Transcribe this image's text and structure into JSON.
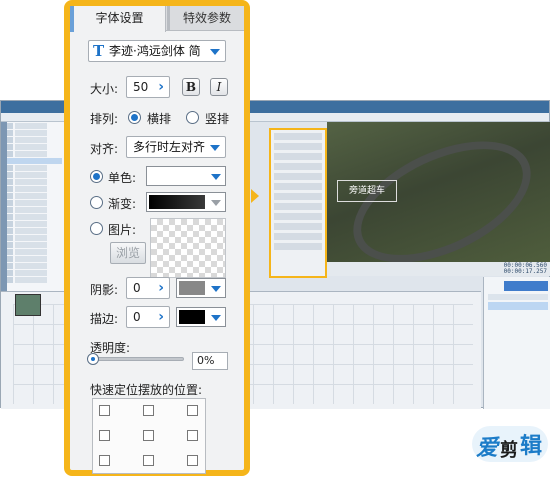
{
  "panel": {
    "tabs": [
      "字体设置",
      "特效参数"
    ],
    "font_name": "李迹·鸿远剑体 简",
    "size_label": "大小:",
    "size_value": "50",
    "bold_label": "B",
    "italic_label": "I",
    "layout_label": "排列:",
    "layout_options": [
      "横排",
      "竖排"
    ],
    "align_label": "对齐:",
    "align_value": "多行时左对齐",
    "fill_options": [
      "单色:",
      "渐变:",
      "图片:"
    ],
    "browse_label": "浏览",
    "shadow_label": "阴影:",
    "shadow_value": "0",
    "stroke_label": "描边:",
    "stroke_value": "0",
    "opacity_label": "透明度:",
    "opacity_value": "0%",
    "position_label": "快速定位摆放的位置:",
    "colors": {
      "solid": "#ffffff",
      "shadow": "#888888",
      "stroke": "#000000",
      "accent": "#f5b51a"
    }
  },
  "background": {
    "caption_text": "旁道超车",
    "time_current": "00:00:06.560",
    "time_total": "00:00:17.257"
  },
  "logo": {
    "text": "爱剪辑"
  }
}
